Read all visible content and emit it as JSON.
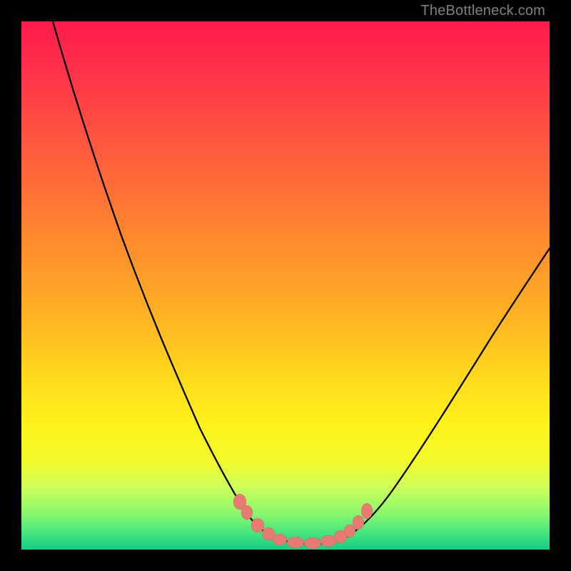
{
  "watermark": "TheBottleneck.com",
  "chart_data": {
    "type": "line",
    "title": "",
    "xlabel": "",
    "ylabel": "",
    "note": "Bottleneck-style V-curve. Y is bottleneck %, X is relative component balance. Lower is better (green). Values are approximate from pixel gradient and curve shape; no axis ticks or numeric labels are printed on the image.",
    "x_range": [
      0,
      100
    ],
    "y_range": [
      0,
      100
    ],
    "curve": {
      "name": "bottleneck",
      "x": [
        6,
        10,
        15,
        20,
        25,
        30,
        33,
        36,
        39,
        42,
        44,
        46,
        48,
        50,
        53,
        56,
        59,
        62,
        66,
        72,
        80,
        90,
        100
      ],
      "y": [
        100,
        92,
        80,
        67,
        53,
        38,
        30,
        23,
        16,
        10,
        6,
        3,
        1.5,
        1,
        1,
        1.5,
        3,
        6,
        11,
        20,
        32,
        46,
        58
      ]
    },
    "markers": {
      "name": "highlighted-points",
      "x": [
        40.5,
        41.5,
        43.5,
        45.0,
        47.0,
        50.0,
        53.5,
        56.0,
        57.5,
        59.0,
        60.5,
        62.0
      ],
      "y": [
        11,
        9,
        5.5,
        3.5,
        2.0,
        1.2,
        1.4,
        2.2,
        3.2,
        4.6,
        6.4,
        8.5
      ]
    },
    "gradient_stops": [
      {
        "pos": 0.0,
        "color": "#ff1a4d"
      },
      {
        "pos": 0.3,
        "color": "#ff6a38"
      },
      {
        "pos": 0.66,
        "color": "#ffd51d"
      },
      {
        "pos": 0.83,
        "color": "#f4fa2a"
      },
      {
        "pos": 1.0,
        "color": "#18cc83"
      }
    ]
  }
}
